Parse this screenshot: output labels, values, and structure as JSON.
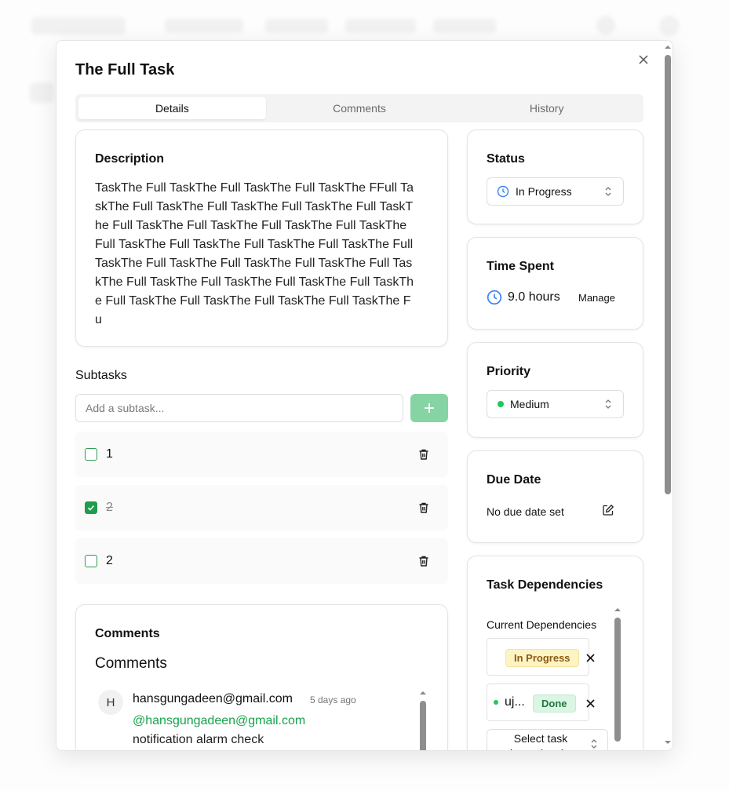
{
  "modal": {
    "title": "The Full Task",
    "tabs": [
      {
        "label": "Details",
        "active": true
      },
      {
        "label": "Comments",
        "active": false
      },
      {
        "label": "History",
        "active": false
      }
    ]
  },
  "description": {
    "title": "Description",
    "text": "TaskThe Full TaskThe Full TaskThe Full TaskThe FFull TaskThe Full TaskThe Full TaskThe Full TaskThe Full TaskThe Full TaskThe Full TaskThe Full TaskThe Full TaskThe Full TaskThe Full TaskThe Full TaskThe Full TaskThe Full TaskThe Full TaskThe Full TaskThe Full TaskThe Full TaskThe Full TaskThe Full TaskThe Full TaskThe Full TaskThe Full TaskThe Full TaskThe Full TaskThe Full TaskThe Fu"
  },
  "subtasks": {
    "title": "Subtasks",
    "input_placeholder": "Add a subtask...",
    "add_button_icon": "plus-icon",
    "items": [
      {
        "label": "1",
        "checked": false
      },
      {
        "label": "2",
        "checked": true
      },
      {
        "label": "2",
        "checked": false
      }
    ]
  },
  "comments": {
    "section_title": "Comments",
    "heading": "Comments",
    "items": [
      {
        "avatar_initial": "H",
        "author": "hansgungadeen@gmail.com",
        "time": "5 days ago",
        "mention": "@hansgungadeen@gmail.com",
        "body": "notification alarm check"
      }
    ]
  },
  "status": {
    "title": "Status",
    "value": "In Progress",
    "icon": "clock-icon",
    "color": "#3b82f6"
  },
  "time_spent": {
    "title": "Time Spent",
    "value": "9.0 hours",
    "manage_label": "Manage",
    "icon": "clock-icon"
  },
  "priority": {
    "title": "Priority",
    "value": "Medium",
    "dot_color": "#22c55e"
  },
  "due_date": {
    "title": "Due Date",
    "value": "No due date set",
    "icon": "edit-icon"
  },
  "dependencies": {
    "title": "Task Dependencies",
    "current_label": "Current Dependencies",
    "items": [
      {
        "name": "",
        "status": "In Progress",
        "status_color": "#fdf4c4"
      },
      {
        "name": "uj...",
        "status": "Done",
        "status_color": "#dcf5e4",
        "dot_color": "#22c55e"
      }
    ],
    "select_placeholder": "Select task dependencies"
  },
  "colors": {
    "accent": "#22c55e",
    "mention": "#16a34a",
    "add_button": "#86d4a3"
  }
}
